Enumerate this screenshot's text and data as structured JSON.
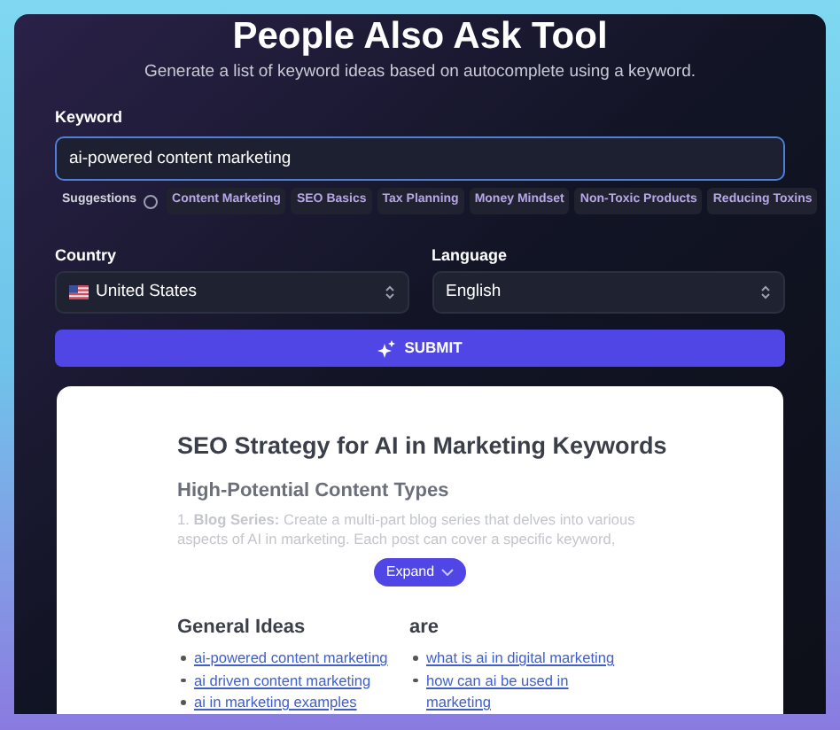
{
  "header": {
    "title": "People Also Ask Tool",
    "subtitle": "Generate a list of keyword ideas based on autocomplete using a keyword."
  },
  "keyword": {
    "label": "Keyword",
    "value": "ai-powered content marketing"
  },
  "suggestions": {
    "label": "Suggestions",
    "items": [
      "Content Marketing",
      "SEO Basics",
      "Tax Planning",
      "Money Mindset",
      "Non-Toxic Products",
      "Reducing Toxins"
    ]
  },
  "country": {
    "label": "Country",
    "value": "United States"
  },
  "language": {
    "label": "Language",
    "value": "English"
  },
  "submit": {
    "label": "SUBMIT"
  },
  "result": {
    "title": "SEO Strategy for AI in Marketing Keywords",
    "section": {
      "title": "High-Potential Content Types",
      "items": [
        "1. **Blog Series:** Create a multi-part blog series that delves into various aspects of AI in marketing. Each post can cover a specific keyword,"
      ]
    },
    "expand": {
      "label": "Expand"
    },
    "columns": [
      {
        "title": "General Ideas",
        "links": [
          "ai-powered content marketing",
          "ai driven content marketing",
          "ai in marketing examples"
        ]
      },
      {
        "title": "are",
        "links": [
          "what is ai in digital marketing",
          "how can ai be used in marketing"
        ]
      }
    ]
  }
}
